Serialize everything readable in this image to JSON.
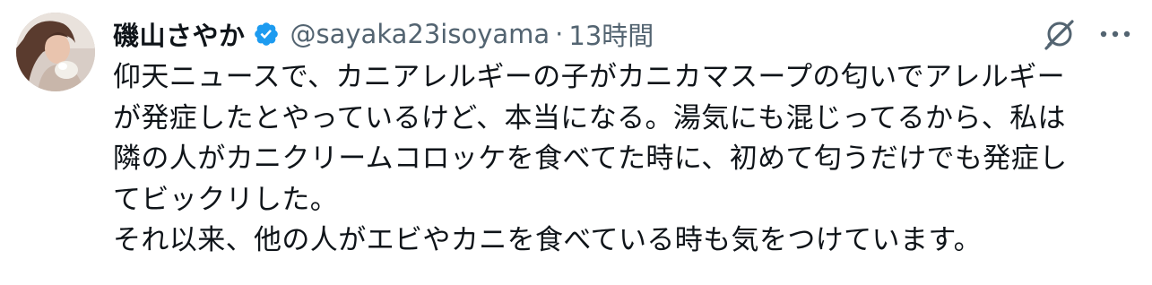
{
  "user": {
    "display_name": "磯山さやか",
    "handle": "@sayaka23isoyama",
    "separator": "·",
    "time": "13時間",
    "verified": true
  },
  "icons": {
    "avatar": "profile-photo",
    "verified": "verified-badge-icon",
    "grok": "grok-icon",
    "more": "more-icon"
  },
  "colors": {
    "verified_badge": "#1d9bf0",
    "text_primary": "#0f1419",
    "text_secondary": "#536471"
  },
  "tweet": {
    "lines": [
      "仰天ニュースで、カニアレルギーの子がカニカマスープの匂いでアレルギー",
      "が発症したとやっているけど、本当になる。湯気にも混じってるから、私は",
      "隣の人がカニクリームコロッケを食べてた時に、初めて匂うだけでも発症し",
      "てビックリした。",
      "それ以来、他の人がエビやカニを食べている時も気をつけています。"
    ]
  }
}
